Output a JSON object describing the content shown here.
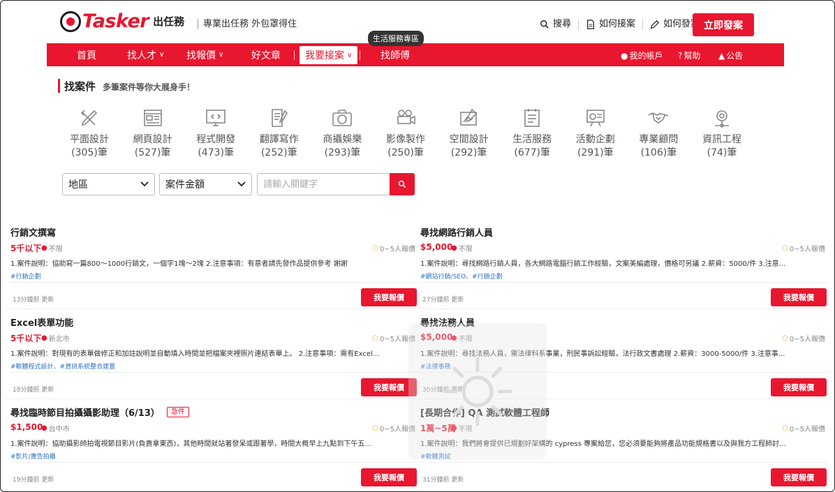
{
  "brand": {
    "name": "Tasker",
    "cn": "出任務",
    "slogan": "專業出任務 外包罩得住"
  },
  "top_links": [
    {
      "label": "搜尋",
      "icon": "search-icon"
    },
    {
      "label": "如何接案",
      "icon": "document-icon"
    },
    {
      "label": "如何發案",
      "icon": "pencil-icon"
    }
  ],
  "post_button": "立即發案",
  "tooltip": "生活服務專區",
  "nav": {
    "items": [
      "首頁",
      "找人才",
      "找報價",
      "好文章",
      "我要接案",
      "找師傅"
    ],
    "account": "我的帳戶",
    "help": "幫助",
    "notice": "公告"
  },
  "section": {
    "title": "找案件",
    "subtitle": "多筆案件等你大展身手！"
  },
  "categories": [
    {
      "name": "平面設計",
      "count": "(305)筆",
      "icon": "pencil-ruler-icon"
    },
    {
      "name": "網頁設計",
      "count": "(527)筆",
      "icon": "webpage-icon"
    },
    {
      "name": "程式開發",
      "count": "(473)筆",
      "icon": "code-monitor-icon"
    },
    {
      "name": "翻譯寫作",
      "count": "(252)筆",
      "icon": "writing-icon"
    },
    {
      "name": "商攝娛樂",
      "count": "(293)筆",
      "icon": "camera-icon"
    },
    {
      "name": "影像製作",
      "count": "(250)筆",
      "icon": "video-camera-icon"
    },
    {
      "name": "空間設計",
      "count": "(292)筆",
      "icon": "blueprint-icon"
    },
    {
      "name": "生活服務",
      "count": "(677)筆",
      "icon": "checklist-icon"
    },
    {
      "name": "活動企劃",
      "count": "(291)筆",
      "icon": "presentation-icon"
    },
    {
      "name": "專業顧問",
      "count": "(106)筆",
      "icon": "handshake-icon"
    },
    {
      "name": "資訊工程",
      "count": "(74)筆",
      "icon": "gear-network-icon"
    }
  ],
  "filters": {
    "region": "地區",
    "amount": "案件金額",
    "search_placeholder": "請輸入關鍵字"
  },
  "cases": [
    {
      "title": "行銷文撰寫",
      "urgent": "",
      "price": "5千以下",
      "location": "不限",
      "offers": "0~5人報價",
      "desc": "1.案件說明：協助寫一篇800～1000行銷文，一個字1塊～2塊 2.注意事項：有意者請先發作品提供參考 謝謝",
      "tags": "#行銷企劃",
      "updated": "13分鐘前 更新",
      "button": "我要報價"
    },
    {
      "title": "尋找網路行銷人員",
      "urgent": "",
      "price": "$5,000",
      "location": "不限",
      "offers": "0~5人報價",
      "desc": "1.案件說明：尋找網路行銷人員，各大網路電腦行銷工作經驗，文案美編處理，價格可另議 2.薪資：5000/件 3.注意...",
      "tags": "#網站行銷/SEO、#行銷企劃",
      "updated": "27分鐘前 更新",
      "button": "我要報價"
    },
    {
      "title": "Excel表單功能",
      "urgent": "",
      "price": "5千以下",
      "location": "新北市",
      "offers": "0~5人報價",
      "desc": "1.案件說明：對現有的表單做修正和加註說明並自動填入時間並把檔案夾裡照片連結表單上。 2.注意事項：需有Excel...",
      "tags": "#軟體程式設計、#資訊系統整合建置",
      "updated": "18分鐘前 更新",
      "button": "我要報價"
    },
    {
      "title": "尋找法務人員",
      "urgent": "",
      "price": "$5,000",
      "location": "不限",
      "offers": "0~5人報價",
      "desc": "1.案件說明：尋找法務人員，需法律科系事業，刑民事訴訟經驗，法行政文書處理 2.薪資：3000-5000/件 3.注意事...",
      "tags": "#法律事務",
      "updated": "30分鐘前 更新",
      "button": "我要報價"
    },
    {
      "title": "尋找臨時節目拍攝攝影助理（6/13）",
      "urgent": "急件",
      "price": "$1,500",
      "location": "台中市",
      "offers": "0~5人報價",
      "desc": "1.案件說明：協助攝影師拍電視節目影片(負責拿東西)，其他時間就站著發呆或跟著學，時間大概早上九點到下午五...",
      "tags": "#影片/廣告拍攝",
      "updated": "19分鐘前 更新",
      "button": "我要報價"
    },
    {
      "title": "[長期合作] QA 測試軟體工程師",
      "urgent": "",
      "price": "1萬~5萬",
      "location": "不限",
      "offers": "0~5人報價",
      "desc": "1.案件說明：我們將會提供已規劃好架構的 cypress 專案給您，您必須要能夠將產品功能規格書以及與我方工程師討...",
      "tags": "#軟體測試",
      "updated": "31分鐘前 更新",
      "button": "我要報價"
    }
  ],
  "colors": {
    "brand_red": "#e8162f",
    "tag_blue": "#2a6fc7"
  }
}
